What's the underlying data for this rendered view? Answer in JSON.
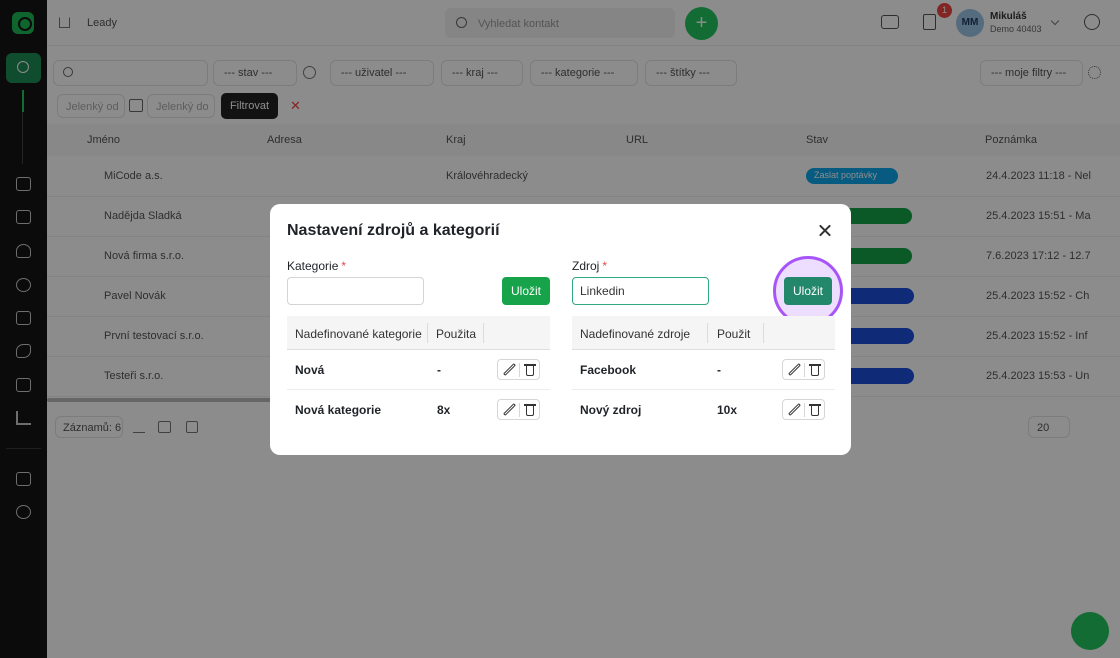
{
  "app": {
    "breadcrumb": "Leady",
    "search_placeholder": "Vyhledat kontakt",
    "user_name": "Mikuláš",
    "user_sub": "Demo 40403",
    "avatar_initials": "MM",
    "notification_count": "1"
  },
  "filters": {
    "stav": "--- stav ---",
    "uzivatel": "--- uživatel ---",
    "kraj": "--- kraj ---",
    "kategorie": "--- kategorie ---",
    "fazlist": "--- štítky ---",
    "moje_filtry": "--- moje filtry ---",
    "date_from": "Jelenký od",
    "date_to": "Jelenký do",
    "filter_button": "Filtrovat"
  },
  "table": {
    "headers": [
      "Jméno",
      "Adresa",
      "Kraj",
      "URL",
      "Stav",
      "Poznámka"
    ],
    "rows": [
      {
        "name": "MiCode a.s.",
        "kraj": "Královéhradecký",
        "stav": "Zaslat poptávky",
        "note": "24.4.2023 11:18 - Nel"
      },
      {
        "name": "Nadějda Sladká",
        "kraj": "",
        "stav": "",
        "note": "25.4.2023 15:51 - Ma"
      },
      {
        "name": "Nová firma s.r.o.",
        "kraj": "",
        "stav": "",
        "note": "7.6.2023 17:12 - 12.7"
      },
      {
        "name": "Pavel Novák",
        "kraj": "",
        "stav": "",
        "note": "25.4.2023 15:52 - Ch"
      },
      {
        "name": "První testovací s.r.o.",
        "kraj": "",
        "stav": "",
        "note": "25.4.2023 15:52 - Inf"
      },
      {
        "name": "Testeři s.r.o.",
        "kraj": "",
        "stav": "",
        "note": "25.4.2023 15:53 - Un"
      }
    ],
    "footer_count": "Záznamů: 6",
    "page_size": "20"
  },
  "modal": {
    "title": "Nastavení zdrojů a kategorií",
    "categories": {
      "label": "Kategorie",
      "required_mark": "*",
      "input_value": "",
      "save_label": "Uložit",
      "headers": [
        "Nadefinované kategorie",
        "Použita"
      ],
      "rows": [
        {
          "name": "Nová",
          "used": "-"
        },
        {
          "name": "Nová kategorie",
          "used": "8x"
        }
      ]
    },
    "sources": {
      "label": "Zdroj",
      "required_mark": "*",
      "input_value": "Linkedin",
      "save_label": "Uložit",
      "headers": [
        "Nadefinované zdroje",
        "Použit"
      ],
      "rows": [
        {
          "name": "Facebook",
          "used": "-"
        },
        {
          "name": "Nový zdroj",
          "used": "10x"
        }
      ]
    }
  },
  "colors": {
    "sidebar": "#141414",
    "accent_green": "#16a34a",
    "highlight_ring": "#a855f7",
    "focus_border": "#2eaa7d"
  }
}
